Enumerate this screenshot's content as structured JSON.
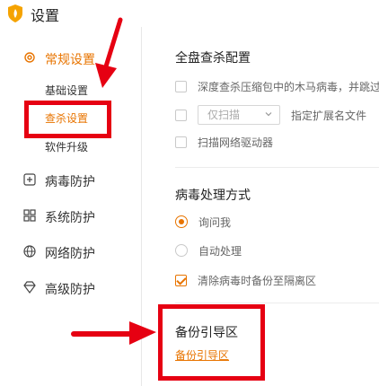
{
  "window": {
    "title": "设置"
  },
  "sidebar": {
    "items": [
      {
        "label": "常规设置",
        "icon": "gear-icon",
        "active": true,
        "sub_items": [
          {
            "label": "基础设置",
            "active": false
          },
          {
            "label": "查杀设置",
            "active": true
          },
          {
            "label": "软件升级",
            "active": false
          }
        ]
      },
      {
        "label": "病毒防护",
        "icon": "plus-square-icon"
      },
      {
        "label": "系统防护",
        "icon": "grid-icon"
      },
      {
        "label": "网络防护",
        "icon": "globe-icon"
      },
      {
        "label": "高级防护",
        "icon": "diamond-icon"
      }
    ]
  },
  "full_scan": {
    "title": "全盘查杀配置",
    "deep_scan_option": {
      "label": "深度查杀压缩包中的木马病毒，并跳过",
      "checked": false
    },
    "scan_mode": {
      "checked": false,
      "selected": "仅扫描",
      "ext_label": "指定扩展名文件"
    },
    "network_drive_option": {
      "label": "扫描网络驱动器",
      "checked": false
    }
  },
  "virus_handling": {
    "title": "病毒处理方式",
    "ask_option": {
      "label": "询问我",
      "selected": true
    },
    "auto_option": {
      "label": "自动处理",
      "selected": false
    },
    "backup_option": {
      "label": "清除病毒时备份至隔离区",
      "checked": true
    }
  },
  "boot_backup": {
    "title": "备份引导区",
    "link": "备份引导区"
  },
  "colors": {
    "accent": "#e87400",
    "annotation": "#e60012"
  }
}
